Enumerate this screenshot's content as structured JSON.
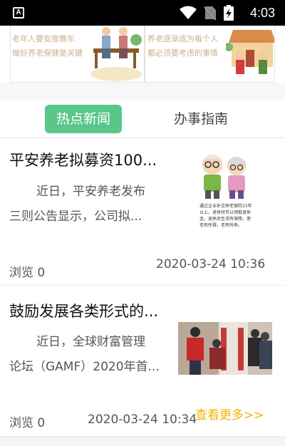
{
  "status_bar": {
    "app_icon_letter": "A",
    "time": "4:03"
  },
  "banner": {
    "left_line1": "老年人要安度晚年",
    "left_line2": "做好养老保健是关键",
    "right_line1": "养老逐渐成为每个人",
    "right_line2": "都必须要考虑的事情"
  },
  "tabs": {
    "active": "热点新闻",
    "inactive": "办事指南"
  },
  "news": [
    {
      "title": "平安养老拟募资100...",
      "body_line1": "近日，平安养老发布",
      "body_line2": "三则公告显示，公司拟...",
      "views": "浏览 0",
      "date": "2020-03-24 10:36",
      "thumb_caption": "通过企业补交养老保险15年以上，退休时可以领取退休金，退休后生活有保障。使老有所得，老有所养。"
    },
    {
      "title": "鼓励发展各类形式的...",
      "body_line1": "近日，全球财富管理",
      "body_line2": "论坛（GAMF）2020年首...",
      "views": "浏览 0",
      "date": "2020-03-24 10:34"
    }
  ],
  "more_link": "查看更多>>",
  "colors": {
    "accent_green": "#5ac68a",
    "more_link": "#f0b400"
  }
}
